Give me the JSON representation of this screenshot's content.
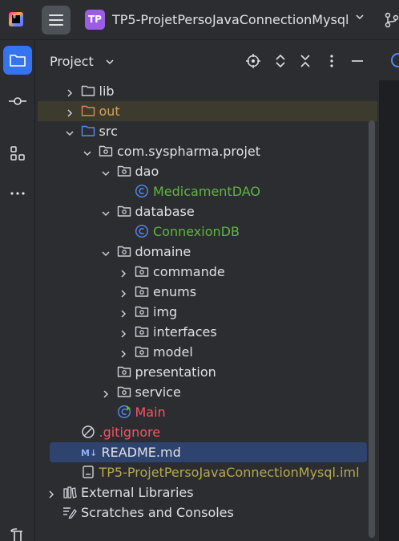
{
  "app": {
    "logo_text": "IJ",
    "project_badge": "TP",
    "project_name": "TP5-ProjetPersoJavaConnectionMysql"
  },
  "panel": {
    "title": "Project"
  },
  "tree": [
    {
      "label": "lib",
      "type": "folder",
      "expanded": false,
      "color": "default"
    },
    {
      "label": "out",
      "type": "folder-excluded",
      "expanded": false,
      "color": "orange"
    },
    {
      "label": "src",
      "type": "folder-source",
      "expanded": true,
      "color": "default"
    },
    {
      "label": "com.syspharma.projet",
      "type": "package",
      "expanded": true,
      "color": "default"
    },
    {
      "label": "dao",
      "type": "package",
      "expanded": true,
      "color": "default"
    },
    {
      "label": "MedicamentDAO",
      "type": "class",
      "color": "green"
    },
    {
      "label": "database",
      "type": "package",
      "expanded": true,
      "color": "default"
    },
    {
      "label": "ConnexionDB",
      "type": "class",
      "color": "green"
    },
    {
      "label": "domaine",
      "type": "package",
      "expanded": true,
      "color": "default"
    },
    {
      "label": "commande",
      "type": "package",
      "expanded": false,
      "color": "default"
    },
    {
      "label": "enums",
      "type": "package",
      "expanded": false,
      "color": "default"
    },
    {
      "label": "img",
      "type": "package",
      "expanded": false,
      "color": "default"
    },
    {
      "label": "interfaces",
      "type": "package",
      "expanded": false,
      "color": "default"
    },
    {
      "label": "model",
      "type": "package",
      "expanded": false,
      "color": "default"
    },
    {
      "label": "presentation",
      "type": "package",
      "expanded": null,
      "color": "default"
    },
    {
      "label": "service",
      "type": "package",
      "expanded": false,
      "color": "default"
    },
    {
      "label": "Main",
      "type": "main-class",
      "color": "red"
    },
    {
      "label": ".gitignore",
      "type": "ignore",
      "color": "red"
    },
    {
      "label": "README.md",
      "type": "markdown",
      "color": "default",
      "selected": true
    },
    {
      "label": "TP5-ProjetPersoJavaConnectionMysql.iml",
      "type": "iml",
      "color": "olive"
    },
    {
      "label": "External Libraries",
      "type": "libraries",
      "expanded": false,
      "color": "default"
    },
    {
      "label": "Scratches and Consoles",
      "type": "scratches",
      "color": "default"
    }
  ],
  "markdown_icon_text": "M↓"
}
